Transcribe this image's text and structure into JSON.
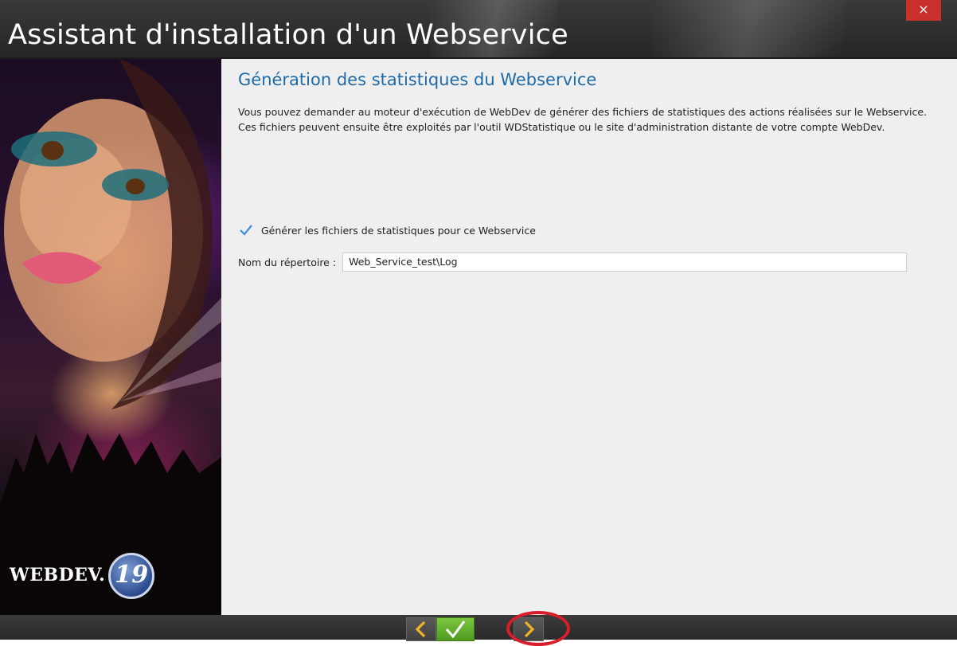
{
  "window": {
    "title": "Assistant d'installation d'un Webservice",
    "close_label": "×"
  },
  "sidebar": {
    "logo_text": "WEBDEV.",
    "logo_version": "19"
  },
  "main": {
    "heading": "Génération des statistiques du Webservice",
    "description": [
      "Vous pouvez demander au moteur d'exécution de WebDev de générer des fichiers de statistiques des actions réalisées sur le Webservice.",
      "Ces fichiers peuvent ensuite être exploités par l'outil WDStatistique ou le site d'administration distante de votre compte WebDev."
    ],
    "checkbox": {
      "label": "Générer les fichiers de statistiques pour ce Webservice",
      "checked": true
    },
    "directory": {
      "label": "Nom du répertoire :",
      "value": "Web_Service_test\\Log"
    }
  },
  "footer": {
    "buttons": [
      {
        "name": "previous",
        "icon": "chevron-left-icon"
      },
      {
        "name": "finish",
        "icon": "check-icon"
      },
      {
        "name": "next",
        "icon": "chevron-right-icon"
      }
    ],
    "colors": {
      "finish": "#5fae2c",
      "arrow": "#f2b324",
      "highlight": "#d81e2a"
    }
  },
  "colors": {
    "heading": "#1e6aa8",
    "close": "#c8302c",
    "checkmark": "#3a8fd8"
  }
}
